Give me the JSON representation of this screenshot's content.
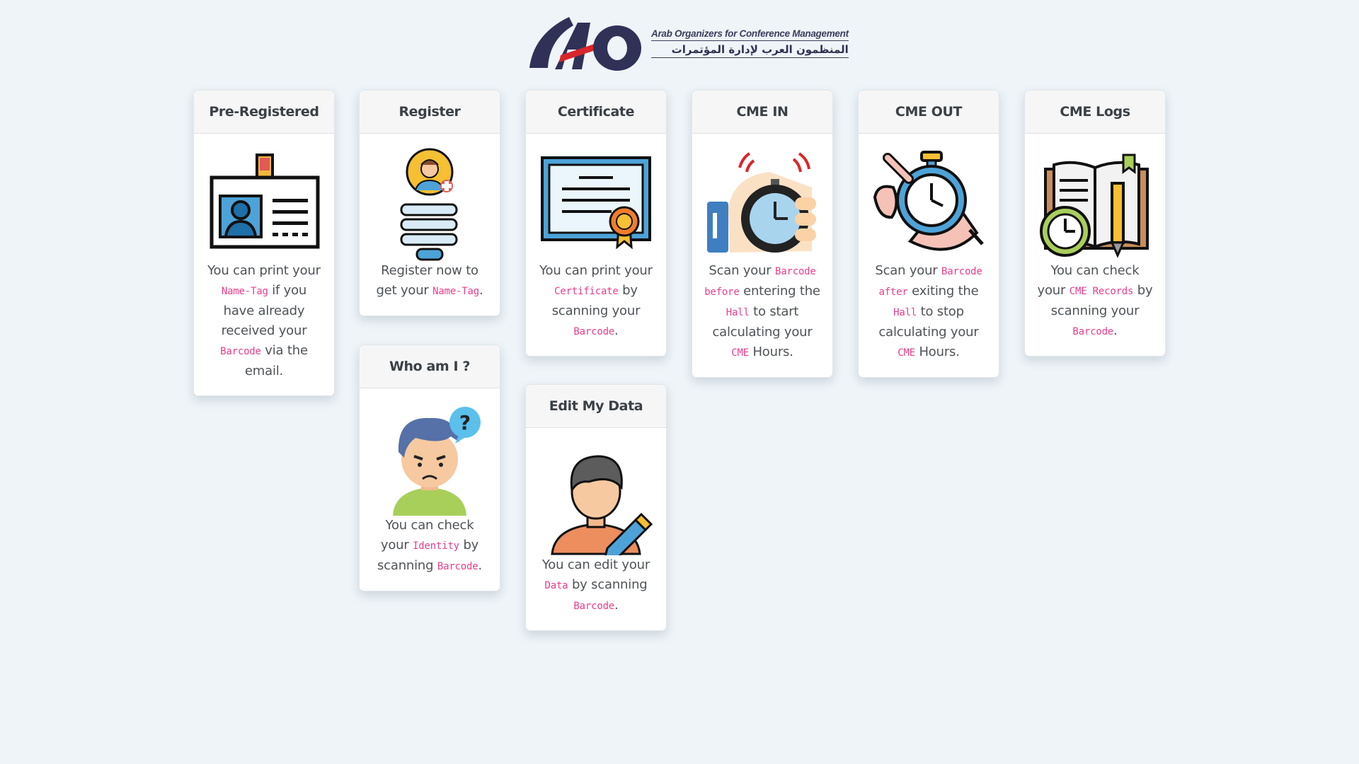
{
  "logo": {
    "mark": "AO",
    "english": "Arab Organizers for Conference Management",
    "arabic": "المنظمون العرب لإدارة المؤتمرات"
  },
  "cards": {
    "preregistered": {
      "title": "Pre-Registered",
      "icon": "id-card-icon",
      "t1": "You can print your ",
      "c1": "Name-Tag",
      "t2": " if you have already received your ",
      "c2": "Barcode",
      "t3": " via the email."
    },
    "register": {
      "title": "Register",
      "icon": "user-register-form-icon",
      "t1": "Register now to get your ",
      "c1": "Name-Tag",
      "t2": "."
    },
    "whoami": {
      "title": "Who am I ?",
      "icon": "confused-person-icon",
      "t1": "You can check your ",
      "c1": "Identity",
      "t2": " by scanning ",
      "c2": "Barcode",
      "t3": "."
    },
    "certificate": {
      "title": "Certificate",
      "icon": "certificate-icon",
      "t1": "You can print your ",
      "c1": "Certificate",
      "t2": " by scanning your ",
      "c2": "Barcode",
      "t3": "."
    },
    "editdata": {
      "title": "Edit My Data",
      "icon": "edit-user-icon",
      "t1": "You can edit your ",
      "c1": "Data",
      "t2": " by scanning ",
      "c2": "Barcode",
      "t3": "."
    },
    "cmein": {
      "title": "CME IN",
      "icon": "stopwatch-start-icon",
      "t1": "Scan your ",
      "c1": "Barcode",
      "t2": " ",
      "c2": "before",
      "t3": " entering the ",
      "c3": "Hall",
      "t4": " to start calculating your ",
      "c4": "CME",
      "t5": " Hours."
    },
    "cmeout": {
      "title": "CME OUT",
      "icon": "stopwatch-stop-icon",
      "t1": "Scan your ",
      "c1": "Barcode",
      "t2": " ",
      "c2": "after",
      "t3": " exiting the ",
      "c3": "Hall",
      "t4": " to stop calculating your ",
      "c4": "CME",
      "t5": " Hours."
    },
    "cmelogs": {
      "title": "CME Logs",
      "icon": "logbook-clock-icon",
      "t1": "You can check your ",
      "c1": "CME Records",
      "t2": " by scanning your ",
      "c2": "Barcode",
      "t3": "."
    }
  }
}
